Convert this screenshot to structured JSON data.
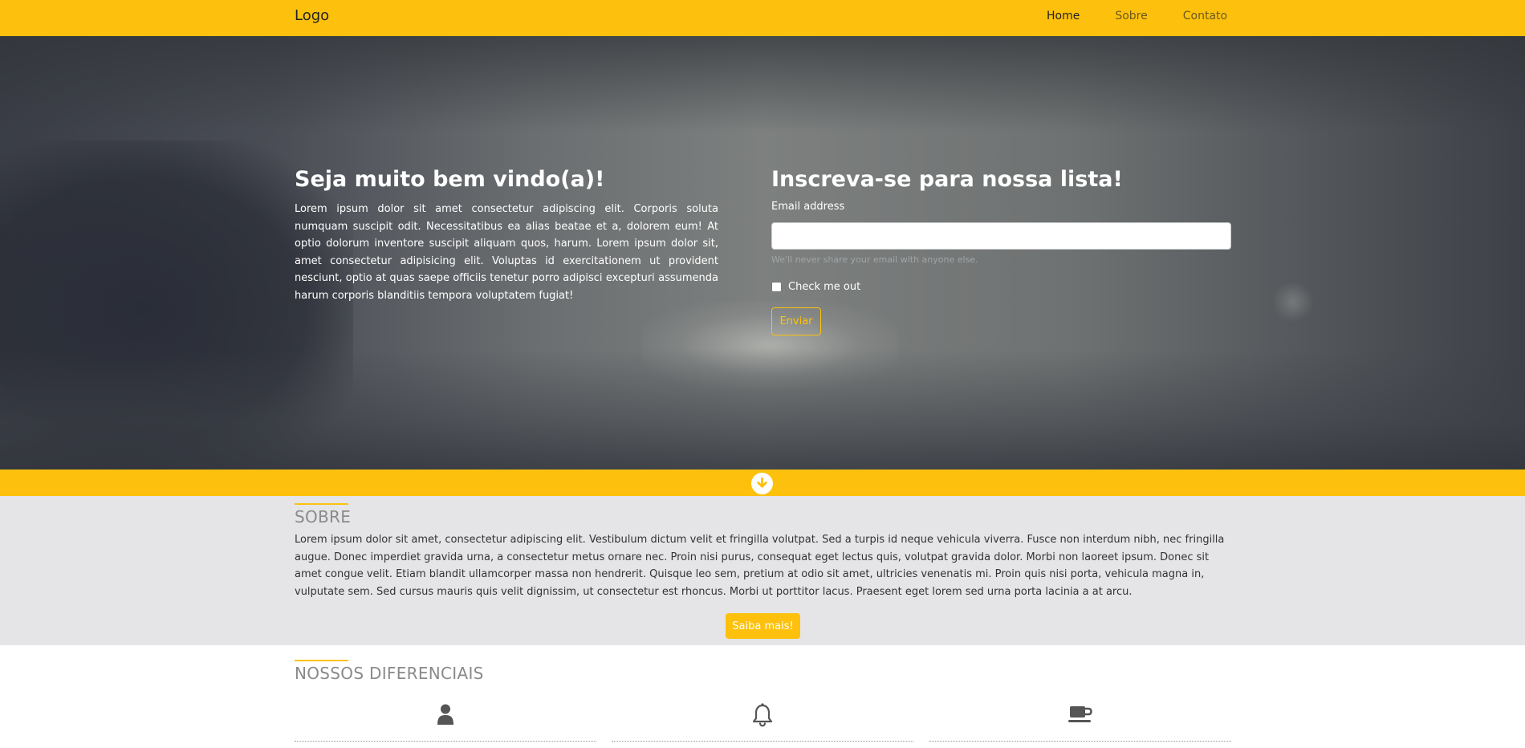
{
  "navbar": {
    "logo": "Logo",
    "links": [
      {
        "label": "Home",
        "active": true
      },
      {
        "label": "Sobre",
        "active": false
      },
      {
        "label": "Contato",
        "active": false
      }
    ]
  },
  "hero": {
    "welcome_title": "Seja muito bem vindo(a)!",
    "welcome_text": "Lorem ipsum dolor sit amet consectetur adipiscing elit. Corporis soluta numquam suscipit odit. Necessitatibus ea alias beatae et a, dolorem eum! At optio dolorum inventore suscipit aliquam quos, harum. Lorem ipsum dolor sit, amet consectetur adipisicing elit. Voluptas id exercitationem ut provident nesciunt, optio at quas saepe officiis tenetur porro adipisci excepturi assumenda harum corporis blanditiis tempora voluptatem fugiat!",
    "signup_title": "Inscreva-se para nossa lista!",
    "email_label": "Email address",
    "email_value": "",
    "email_help": "We'll never share your email with anyone else.",
    "checkbox_label": "Check me out",
    "checkbox_checked": false,
    "submit_label": "Enviar"
  },
  "strip": {
    "icon": "arrow-circle-down-icon"
  },
  "sobre": {
    "title": "SOBRE",
    "text": "Lorem ipsum dolor sit amet, consectetur adipiscing elit. Vestibulum dictum velit et fringilla volutpat. Sed a turpis id neque vehicula viverra. Fusce non interdum nibh, nec fringilla augue. Donec imperdiet gravida urna, a consectetur metus ornare nec. Proin nisi purus, consequat eget lectus quis, volutpat gravida dolor. Morbi non laoreet ipsum. Donec sit amet congue velit. Etiam blandit ullamcorper massa non hendrerit. Quisque leo sem, pretium at odio sit amet, ultricies venenatis mi. Proin quis nisi porta, vehicula magna in, vulputate sem. Sed cursus mauris quis velit dignissim, ut consectetur est rhoncus. Morbi ut porttitor lacus. Praesent eget lorem sed urna porta lacinia a at arcu.",
    "button_label": "Saiba mais!"
  },
  "diferenciais": {
    "title": "NOSSOS DIFERENCIAIS",
    "items": [
      {
        "icon": "user-icon"
      },
      {
        "icon": "bell-icon"
      },
      {
        "icon": "coffee-cup-icon"
      }
    ]
  },
  "colors": {
    "accent": "#fdc10d",
    "section_bg": "#e5e5e7",
    "icon": "#555555"
  }
}
